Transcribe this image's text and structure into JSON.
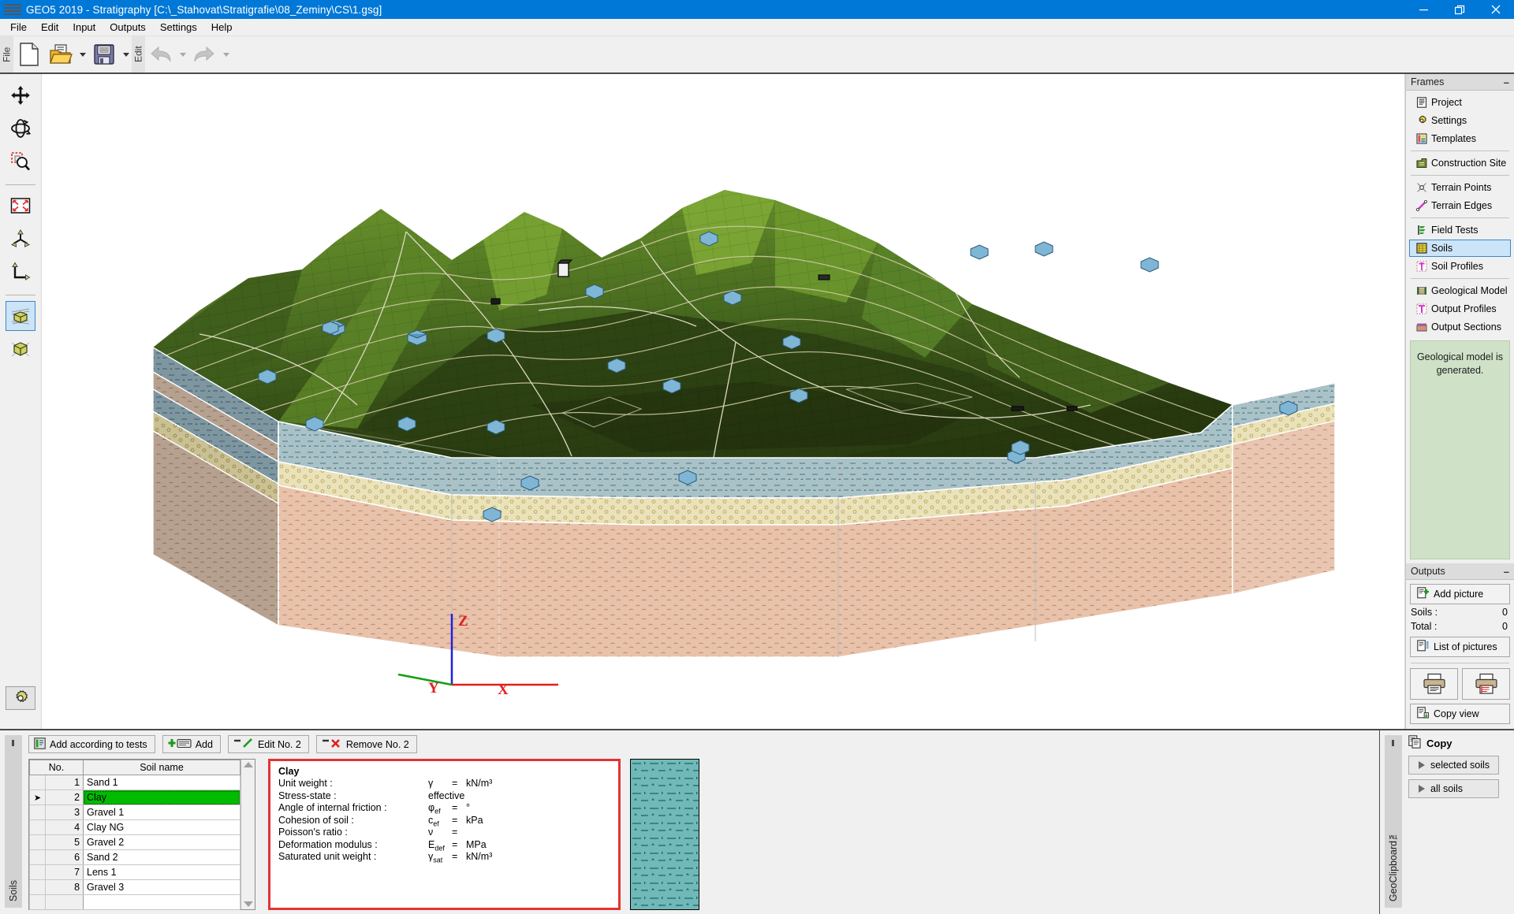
{
  "window": {
    "title": "GEO5 2019 - Stratigraphy [C:\\_Stahovat\\Stratigrafie\\08_Zeminy\\CS\\1.gsg]",
    "minimize_label": "Minimize",
    "restore_label": "Restore",
    "close_label": "Close"
  },
  "menu": [
    {
      "label": "File"
    },
    {
      "label": "Edit"
    },
    {
      "label": "Input"
    },
    {
      "label": "Outputs"
    },
    {
      "label": "Settings"
    },
    {
      "label": "Help"
    }
  ],
  "toolbar": {
    "file_group": "File",
    "edit_group": "Edit",
    "new_label": "New",
    "open_label": "Open",
    "save_label": "Save",
    "undo_label": "Undo",
    "redo_label": "Redo"
  },
  "view_tools": [
    {
      "name": "pan-tool",
      "label": "Move"
    },
    {
      "name": "rotate-tool",
      "label": "Rotate"
    },
    {
      "name": "zoom-window-tool",
      "label": "Zoom window"
    },
    {
      "name": "fit-to-screen-tool",
      "label": "Fit to screen"
    },
    {
      "name": "axonometry-tool",
      "label": "Axonometric view"
    },
    {
      "name": "plan-view-tool",
      "label": "Plan view"
    },
    {
      "name": "cut-model-tool",
      "label": "Model with cut"
    },
    {
      "name": "solid-model-tool",
      "label": "Solid model"
    }
  ],
  "view_settings_label": "View settings",
  "canvas": {
    "axis_x": "X",
    "axis_y": "Y",
    "axis_z": "Z"
  },
  "frames": {
    "header": "Frames",
    "minimize": "–",
    "items": [
      {
        "label": "Project",
        "icon": "document-icon",
        "selected": false
      },
      {
        "label": "Settings",
        "icon": "gear-icon",
        "selected": false
      },
      {
        "label": "Templates",
        "icon": "templates-icon",
        "selected": false
      },
      {
        "label": "Construction Site",
        "icon": "construction-site-icon",
        "selected": false
      },
      {
        "label": "Terrain Points",
        "icon": "terrain-points-icon",
        "selected": false
      },
      {
        "label": "Terrain Edges",
        "icon": "terrain-edges-icon",
        "selected": false
      },
      {
        "label": "Field Tests",
        "icon": "field-tests-icon",
        "selected": false
      },
      {
        "label": "Soils",
        "icon": "soils-icon",
        "selected": true
      },
      {
        "label": "Soil Profiles",
        "icon": "soil-profiles-icon",
        "selected": false
      },
      {
        "label": "Geological Model",
        "icon": "geological-model-icon",
        "selected": false
      },
      {
        "label": "Output Profiles",
        "icon": "output-profiles-icon",
        "selected": false
      },
      {
        "label": "Output Sections",
        "icon": "output-sections-icon",
        "selected": false
      }
    ]
  },
  "status": {
    "message": "Geological model is generated."
  },
  "outputs": {
    "header": "Outputs",
    "minimize": "–",
    "add_picture": "Add picture",
    "soils_label": "Soils :",
    "soils_value": "0",
    "total_label": "Total :",
    "total_value": "0",
    "list_of_pictures": "List of pictures",
    "print_label": "Print",
    "print_preview_label": "Print preview",
    "copy_view": "Copy view"
  },
  "bottom": {
    "tab_label": "Soils",
    "buttons": [
      {
        "label": "Add according to tests",
        "icon": "add-from-tests-icon"
      },
      {
        "label": "Add",
        "icon": "add-icon"
      },
      {
        "label": "Edit No. 2",
        "icon": "edit-icon"
      },
      {
        "label": "Remove No. 2",
        "icon": "remove-icon"
      }
    ],
    "table": {
      "headers": [
        "No.",
        "Soil name"
      ],
      "rows": [
        {
          "no": "1",
          "name": "Sand 1",
          "selected": false
        },
        {
          "no": "2",
          "name": "Clay",
          "selected": true
        },
        {
          "no": "3",
          "name": "Gravel 1",
          "selected": false
        },
        {
          "no": "4",
          "name": "Clay NG",
          "selected": false
        },
        {
          "no": "5",
          "name": "Gravel 2",
          "selected": false
        },
        {
          "no": "6",
          "name": "Sand 2",
          "selected": false
        },
        {
          "no": "7",
          "name": "Lens 1",
          "selected": false
        },
        {
          "no": "8",
          "name": "Gravel 3",
          "selected": false
        }
      ]
    },
    "detail": {
      "title": "Clay",
      "properties": [
        {
          "label": "Unit weight :",
          "symbol": "γ",
          "sub": "",
          "eq": "=",
          "value": "",
          "unit": "kN/m³"
        },
        {
          "label": "Stress-state :",
          "symbol": "",
          "sub": "",
          "eq": "",
          "value": "effective",
          "unit": ""
        },
        {
          "label": "Angle of internal friction :",
          "symbol": "φ",
          "sub": "ef",
          "eq": "=",
          "value": "",
          "unit": "°"
        },
        {
          "label": "Cohesion of soil :",
          "symbol": "c",
          "sub": "ef",
          "eq": "=",
          "value": "",
          "unit": "kPa"
        },
        {
          "label": "Poisson's ratio :",
          "symbol": "ν",
          "sub": "",
          "eq": "=",
          "value": "",
          "unit": ""
        },
        {
          "label": "Deformation modulus :",
          "symbol": "E",
          "sub": "def",
          "eq": "=",
          "value": "",
          "unit": "MPa"
        },
        {
          "label": "Saturated unit weight :",
          "symbol": "γ",
          "sub": "sat",
          "eq": "=",
          "value": "",
          "unit": "kN/m³"
        }
      ],
      "pattern_color": "#71b8b8",
      "pattern_line_color": "#1d6a6a"
    },
    "clipboard": {
      "tab_label": "GeoClipboard™",
      "copy_label": "Copy",
      "selected_soils": "selected soils",
      "all_soils": "all soils"
    }
  },
  "colors": {
    "accent": "#0078d7",
    "selection_green": "#00bb00",
    "highlight_red": "#e23434",
    "status_green_bg": "#cfe2c8",
    "terrain_green_light": "#7fa832",
    "terrain_green_dark": "#2c4216",
    "layer_clay_blue": "#9fbcc4",
    "layer_sand_yellow": "#e8e0bb",
    "layer_gravel_pink": "#e6bfa8",
    "layer_gravel_brown": "#b59f8f",
    "borehole_blue": "#6fa8cc"
  }
}
